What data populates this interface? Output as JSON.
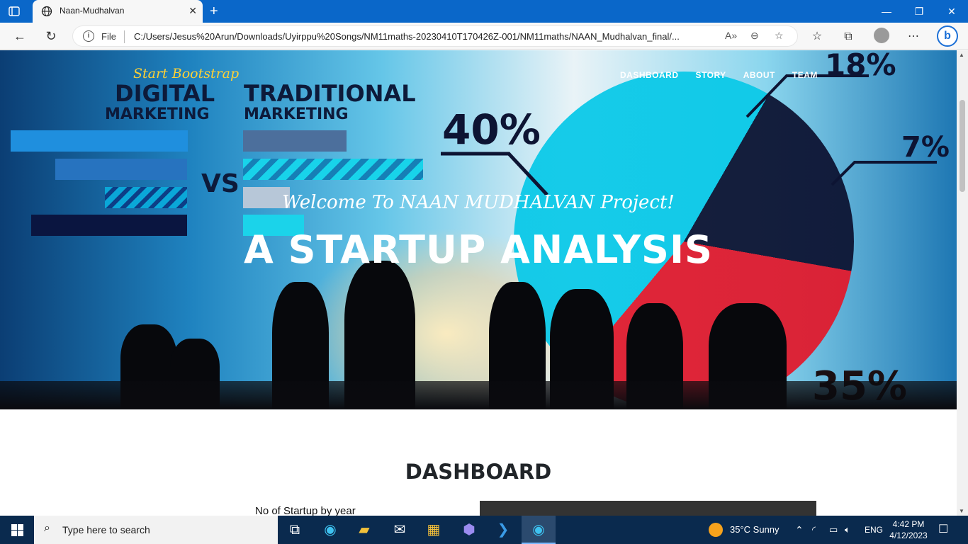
{
  "browser": {
    "tab_title": "Naan-Mudhalvan",
    "url_scheme": "File",
    "url": "C:/Users/Jesus%20Arun/Downloads/Uyirppu%20Songs/NM11maths-20230410T170426Z-001/NM11maths/NAAN_Mudhalvan_final/..."
  },
  "site": {
    "brand": "Start Bootstrap",
    "nav": [
      "DASHBOARD",
      "STORY",
      "ABOUT",
      "TEAM"
    ]
  },
  "hero": {
    "subheading": "Welcome To NAAN MUDHALVAN Project!",
    "heading": "A STARTUP ANALYSIS",
    "image_text": {
      "digital": "DIGITAL",
      "marketing_left": "MARKETING",
      "traditional": "TRADITIONAL",
      "marketing_right": "MARKETING",
      "vs": "VS",
      "pct_40": "40%",
      "pct_18": "18%",
      "pct_7": "7%",
      "pct_35": "35%"
    }
  },
  "dashboard": {
    "title": "DASHBOARD",
    "chart_label": "No of Startup by year"
  },
  "taskbar": {
    "search_placeholder": "Type here to search",
    "weather": "35°C  Sunny",
    "language": "ENG",
    "time": "4:42 PM",
    "date": "4/12/2023"
  },
  "colors": {
    "titlebar": "#0a67c9",
    "brand_yellow": "#fed136",
    "taskbar": "#0a2a4e"
  }
}
